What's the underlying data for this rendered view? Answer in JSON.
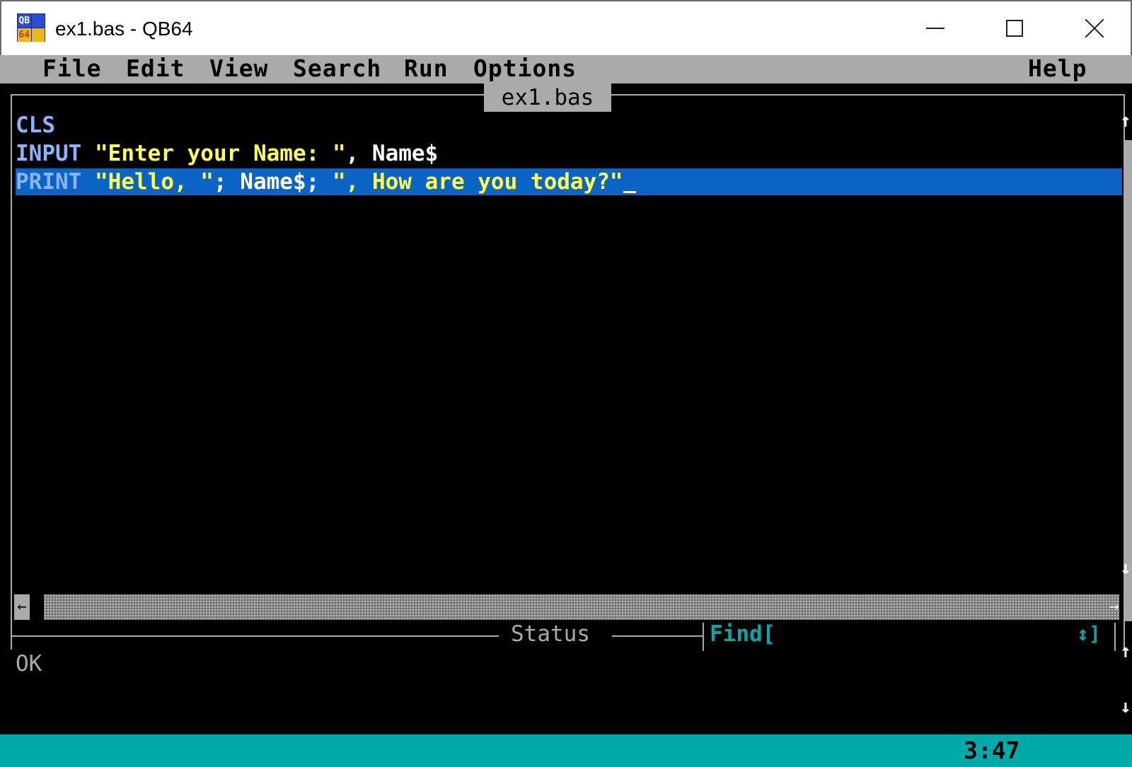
{
  "window": {
    "title": "ex1.bas - QB64",
    "icon_name": "qb64-app-icon",
    "icon_text": [
      "QB",
      "64"
    ]
  },
  "menu": {
    "items": [
      "File",
      "Edit",
      "View",
      "Search",
      "Run",
      "Options"
    ],
    "help": "Help"
  },
  "editor": {
    "file_tab": "ex1.bas",
    "lines": [
      {
        "kw": "CLS",
        "rest": []
      },
      {
        "kw": "INPUT",
        "rest": [
          " ",
          "\"Enter your Name: \"",
          ", Name$"
        ]
      },
      {
        "kw": "PRINT",
        "rest": [
          " ",
          "\"Hello, \"",
          "; Name$; ",
          "\", How are you today?\""
        ]
      }
    ],
    "highlighted_line": 3
  },
  "status": {
    "title": "Status",
    "find_label": "Find[",
    "find_end": "↕]",
    "message": "OK"
  },
  "bottom_bar": {
    "cursor_position": "3:47"
  },
  "colors": {
    "menu_bg": "#aaaaaa",
    "editor_bg": "#000000",
    "keyword": "#8ab4ff",
    "string": "#ffff55",
    "highlight": "#0a64c4",
    "status_bar": "#00aaaa"
  }
}
